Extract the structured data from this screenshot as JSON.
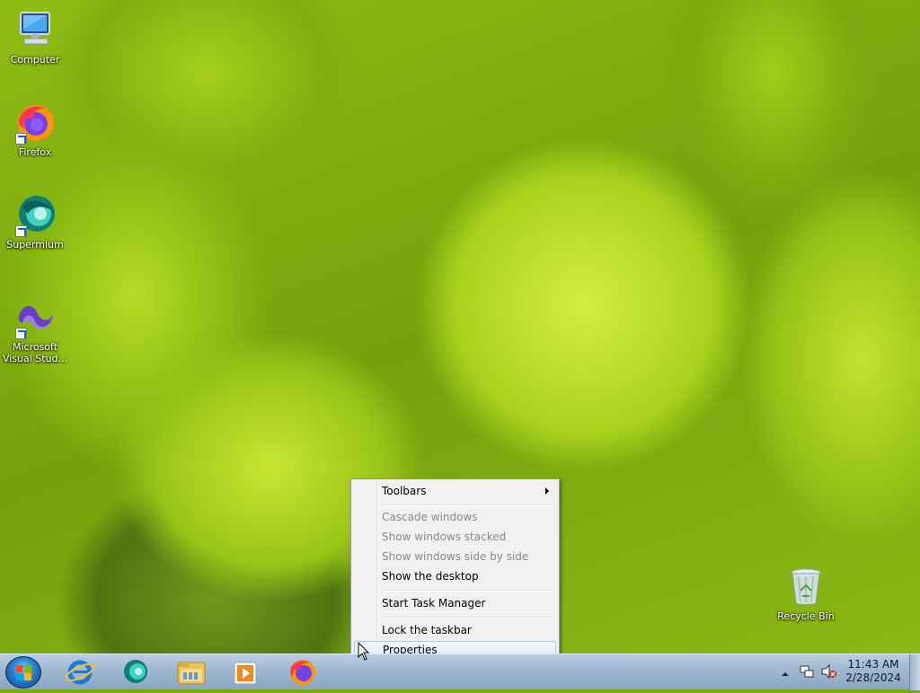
{
  "desktop": {
    "icons": [
      {
        "label": "Computer",
        "icon": "computer-icon"
      },
      {
        "label": "Firefox",
        "icon": "firefox-icon"
      },
      {
        "label": "Supermium",
        "icon": "supermium-icon"
      },
      {
        "label": "Microsoft Visual Stud...",
        "icon": "visual-studio-icon"
      },
      {
        "label": "Recycle Bin",
        "icon": "recycle-bin-icon"
      }
    ]
  },
  "context_menu": {
    "items": [
      {
        "label": "Toolbars",
        "enabled": true,
        "submenu": true
      },
      {
        "label": "Cascade windows",
        "enabled": false
      },
      {
        "label": "Show windows stacked",
        "enabled": false
      },
      {
        "label": "Show windows side by side",
        "enabled": false
      },
      {
        "label": "Show the desktop",
        "enabled": true
      },
      {
        "label": "Start Task Manager",
        "enabled": true
      },
      {
        "label": "Lock the taskbar",
        "enabled": true
      },
      {
        "label": "Properties",
        "enabled": true,
        "highlighted": true
      }
    ]
  },
  "taskbar": {
    "start": "start-orb-icon",
    "pinned_apps": [
      "internet-explorer-icon",
      "supermium-icon",
      "file-explorer-icon",
      "media-player-icon",
      "firefox-icon"
    ],
    "tray_icons": [
      "show-hidden-icons-chevron",
      "network-icon",
      "volume-muted-icon"
    ],
    "clock": {
      "time": "11:43 AM",
      "date": "2/28/2024"
    }
  },
  "colors": {
    "menu_bg": "#f1f1f1",
    "highlight_border": "#a8c8ec",
    "taskbar": "#9fb8cf"
  }
}
